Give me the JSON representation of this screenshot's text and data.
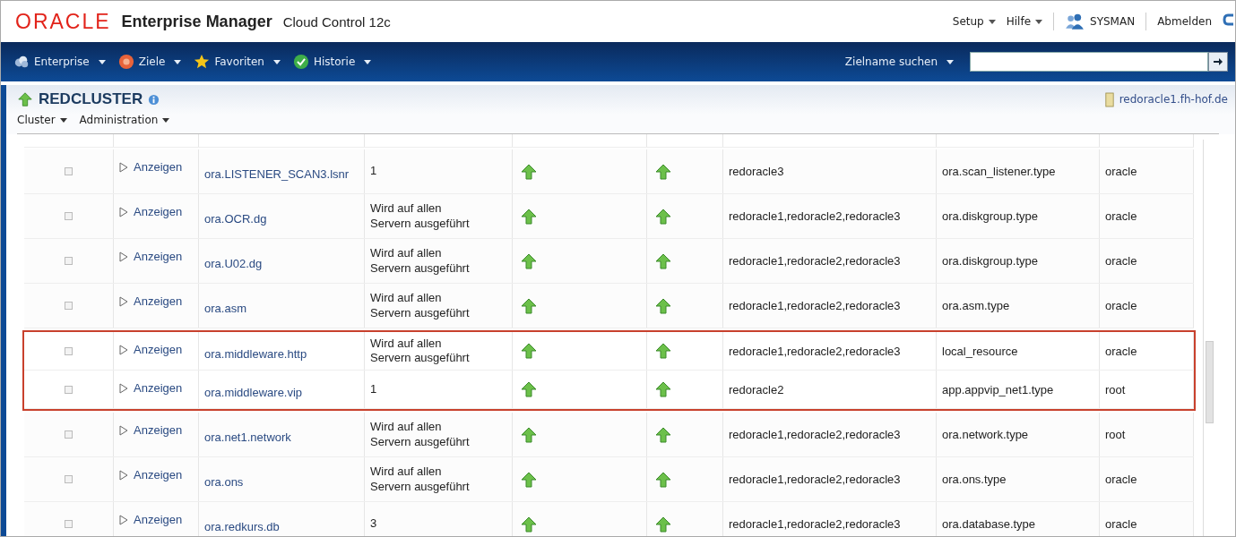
{
  "header": {
    "logo": "ORACLE",
    "product": "Enterprise Manager",
    "edition": "Cloud Control 12c",
    "menus": [
      "Setup",
      "Hilfe"
    ],
    "user": "SYSMAN",
    "logout": "Abmelden"
  },
  "nav": {
    "menus": [
      {
        "label": "Enterprise",
        "kind": "enterprise"
      },
      {
        "label": "Ziele",
        "kind": "targets"
      },
      {
        "label": "Favoriten",
        "kind": "favorites"
      },
      {
        "label": "Historie",
        "kind": "history"
      }
    ],
    "search_label": "Zielname suchen"
  },
  "target": {
    "name": "REDCLUSTER",
    "up": true,
    "host": "redoracle1.fh-hof.de",
    "menus": [
      "Cluster",
      "Administration"
    ]
  },
  "rows": [
    {
      "checked": false,
      "action": "Anzeigen",
      "name": "ora.LISTENER_SCAN3.lsnr",
      "running": "1",
      "up": true,
      "target_up": true,
      "servers": "redoracle3",
      "type": "ora.scan_listener.type",
      "owner": "oracle",
      "highlighted": false
    },
    {
      "checked": false,
      "action": "Anzeigen",
      "name": "ora.OCR.dg",
      "running": "Wird auf allen Servern ausgeführt",
      "up": true,
      "target_up": true,
      "servers": "redoracle1,redoracle2,redoracle3",
      "type": "ora.diskgroup.type",
      "owner": "oracle",
      "highlighted": false
    },
    {
      "checked": false,
      "action": "Anzeigen",
      "name": "ora.U02.dg",
      "running": "Wird auf allen Servern ausgeführt",
      "up": true,
      "target_up": true,
      "servers": "redoracle1,redoracle2,redoracle3",
      "type": "ora.diskgroup.type",
      "owner": "oracle",
      "highlighted": false
    },
    {
      "checked": false,
      "action": "Anzeigen",
      "name": "ora.asm",
      "running": "Wird auf allen Servern ausgeführt",
      "up": true,
      "target_up": true,
      "servers": "redoracle1,redoracle2,redoracle3",
      "type": "ora.asm.type",
      "owner": "oracle",
      "highlighted": false
    },
    {
      "checked": false,
      "action": "Anzeigen",
      "name": "ora.middleware.http",
      "running": "Wird auf allen Servern ausgeführt",
      "up": true,
      "target_up": true,
      "servers": "redoracle1,redoracle2,redoracle3",
      "type": "local_resource",
      "owner": "oracle",
      "highlighted": true
    },
    {
      "checked": false,
      "action": "Anzeigen",
      "name": "ora.middleware.vip",
      "running": "1",
      "up": true,
      "target_up": true,
      "servers": "redoracle2",
      "type": "app.appvip_net1.type",
      "owner": "root",
      "highlighted": true
    },
    {
      "checked": false,
      "action": "Anzeigen",
      "name": "ora.net1.network",
      "running": "Wird auf allen Servern ausgeführt",
      "up": true,
      "target_up": true,
      "servers": "redoracle1,redoracle2,redoracle3",
      "type": "ora.network.type",
      "owner": "root",
      "highlighted": false
    },
    {
      "checked": false,
      "action": "Anzeigen",
      "name": "ora.ons",
      "running": "Wird auf allen Servern ausgeführt",
      "up": true,
      "target_up": true,
      "servers": "redoracle1,redoracle2,redoracle3",
      "type": "ora.ons.type",
      "owner": "oracle",
      "highlighted": false
    },
    {
      "checked": false,
      "action": "Anzeigen",
      "name": "ora.redkurs.db",
      "running": "3",
      "up": true,
      "target_up": true,
      "servers": "redoracle1,redoracle2,redoracle3",
      "type": "ora.database.type",
      "owner": "oracle",
      "highlighted": false
    }
  ]
}
